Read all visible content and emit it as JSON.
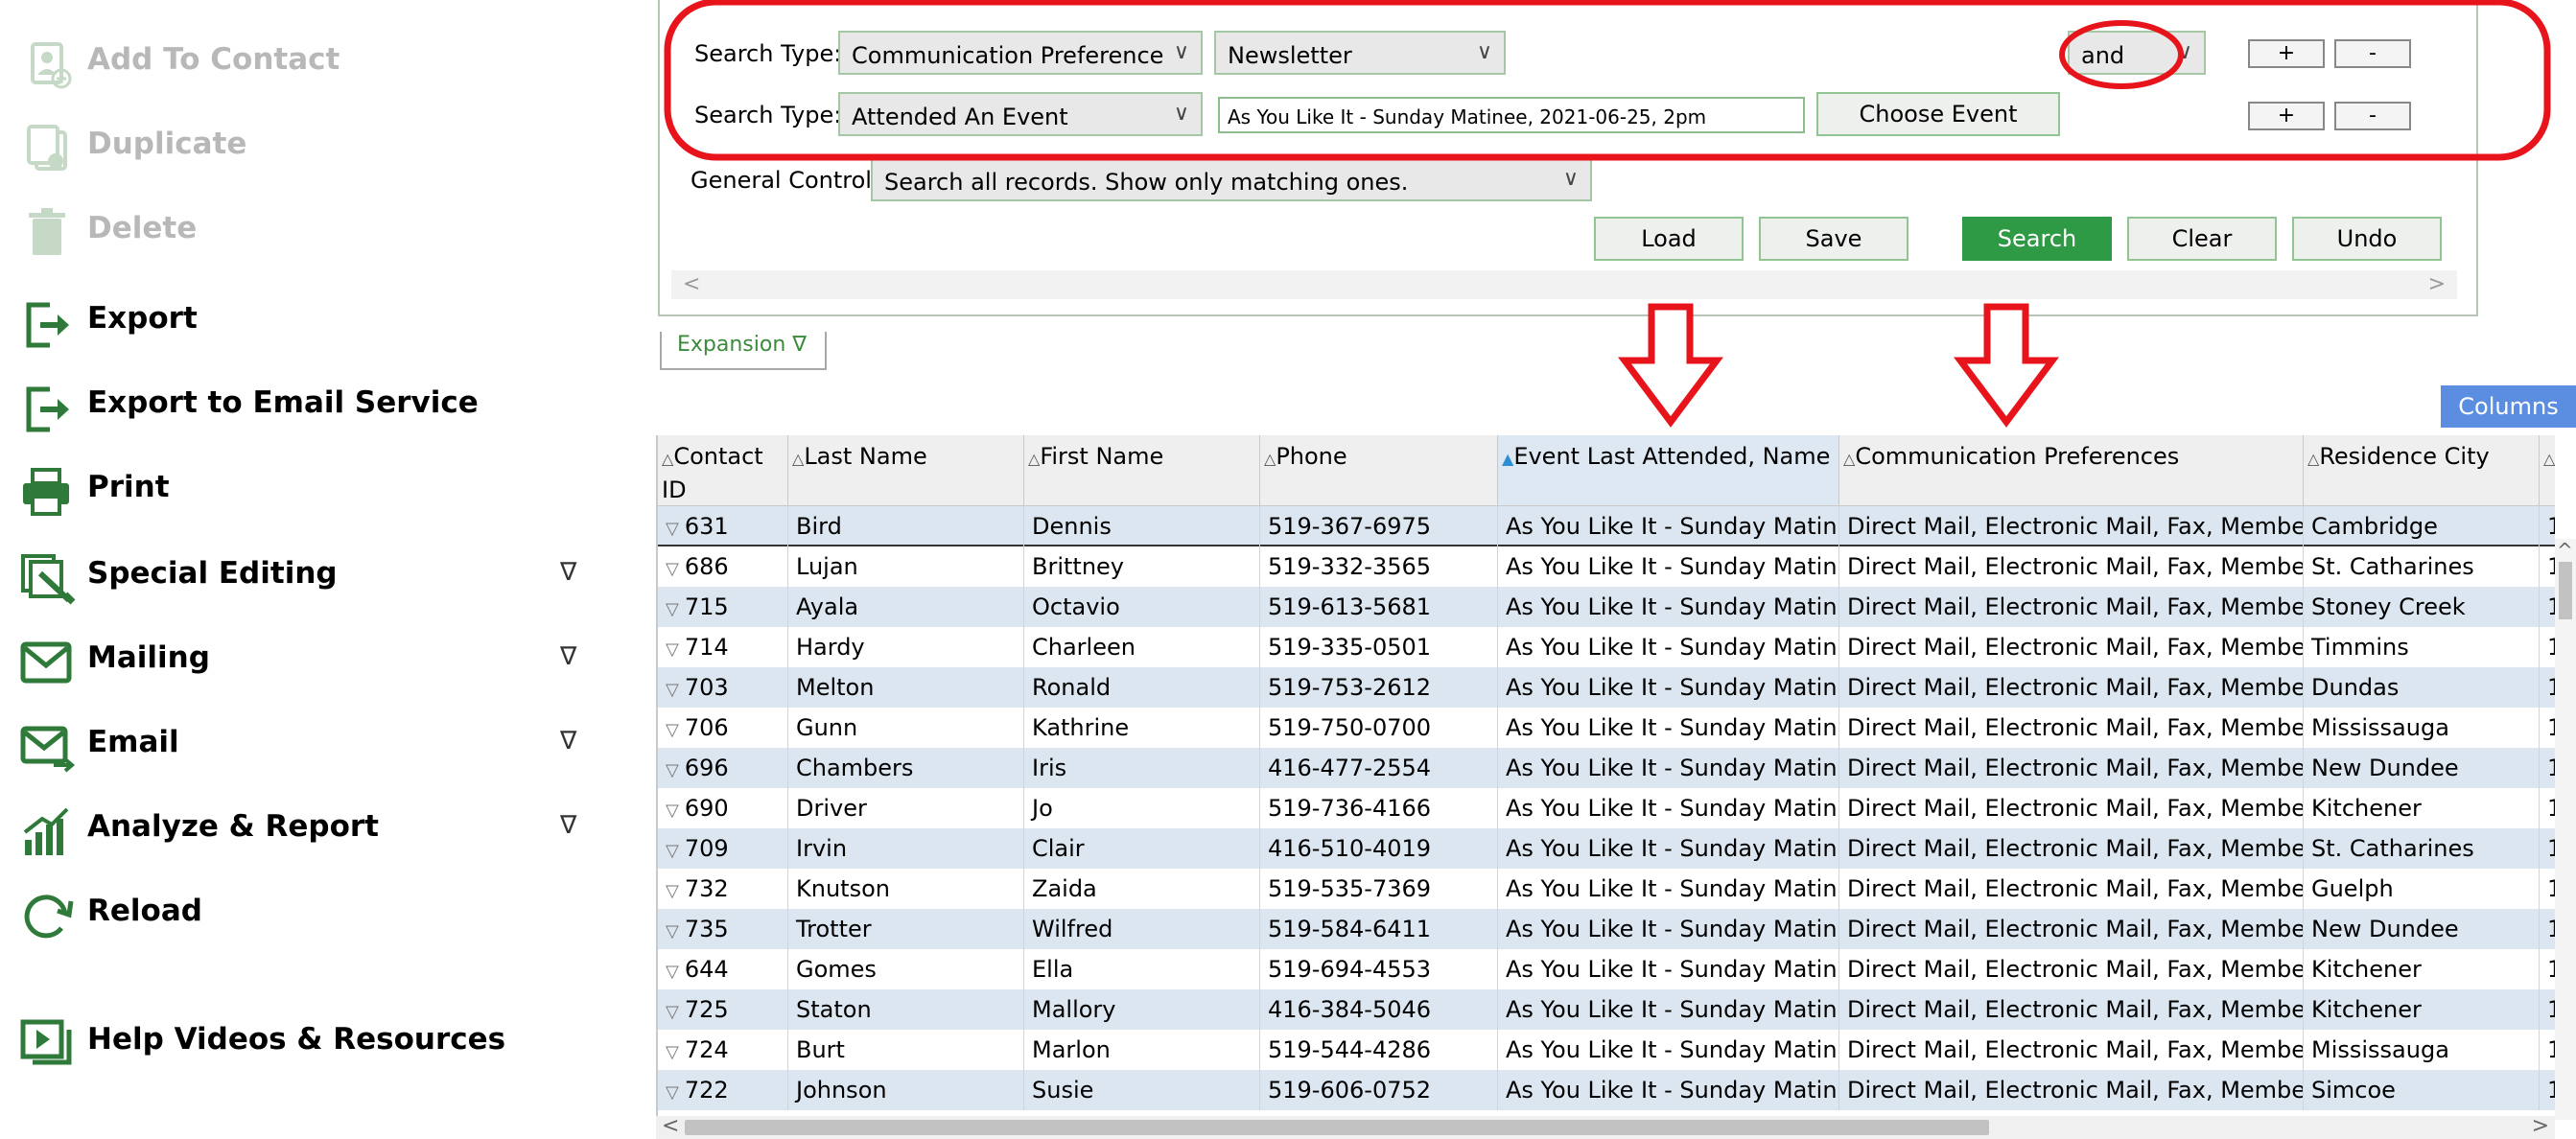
{
  "sidebar": {
    "items": [
      {
        "label": "Add To Contact",
        "icon": "add-to-contact-icon",
        "disabled": true,
        "has_submenu": false
      },
      {
        "label": "Duplicate",
        "icon": "duplicate-icon",
        "disabled": true,
        "has_submenu": false
      },
      {
        "label": "Delete",
        "icon": "trash-icon",
        "disabled": true,
        "has_submenu": false
      },
      {
        "label": "Export",
        "icon": "export-icon",
        "disabled": false,
        "has_submenu": false
      },
      {
        "label": "Export to Email Service",
        "icon": "export-icon",
        "disabled": false,
        "has_submenu": false
      },
      {
        "label": "Print",
        "icon": "printer-icon",
        "disabled": false,
        "has_submenu": false
      },
      {
        "label": "Special Editing",
        "icon": "special-editing-icon",
        "disabled": false,
        "has_submenu": true
      },
      {
        "label": "Mailing",
        "icon": "mail-icon",
        "disabled": false,
        "has_submenu": true
      },
      {
        "label": "Email",
        "icon": "email-icon",
        "disabled": false,
        "has_submenu": true
      },
      {
        "label": "Analyze & Report",
        "icon": "bar-chart-icon",
        "disabled": false,
        "has_submenu": true
      },
      {
        "label": "Reload",
        "icon": "reload-icon",
        "disabled": false,
        "has_submenu": false
      },
      {
        "label": "Help Videos & Resources",
        "icon": "video-help-icon",
        "disabled": false,
        "has_submenu": false
      }
    ],
    "submenu_glyph": "∇"
  },
  "search": {
    "rows": [
      {
        "label": "Search Type:",
        "type_value": "Communication Preference",
        "value": "Newsletter",
        "connector": "and",
        "plus": "+",
        "minus": "-"
      },
      {
        "label": "Search Type:",
        "type_value": "Attended An Event",
        "value": "As You Like It - Sunday Matinee, 2021-06-25, 2pm",
        "choose_button": "Choose Event",
        "plus": "+",
        "minus": "-"
      }
    ],
    "general_control_label": "General Control:",
    "general_control_value": "Search all records. Show only matching ones.",
    "buttons": {
      "load": "Load",
      "save": "Save",
      "search": "Search",
      "clear": "Clear",
      "undo": "Undo"
    }
  },
  "expansion_label": "Expansion ∇",
  "columns_button": "Columns",
  "grid": {
    "headers": [
      {
        "label": "Contact ID"
      },
      {
        "label": "Last Name"
      },
      {
        "label": "First Name"
      },
      {
        "label": "Phone"
      },
      {
        "label": "Event Last Attended, Name",
        "sorted": true
      },
      {
        "label": "Communication Preferences"
      },
      {
        "label": "Residence City"
      },
      {
        "label": ""
      }
    ],
    "rows": [
      [
        "631",
        "Bird",
        "Dennis",
        "519-367-6975",
        "As You Like It - Sunday Matinee",
        "Direct Mail, Electronic Mail, Fax, Member",
        "Cambridge",
        "1"
      ],
      [
        "686",
        "Lujan",
        "Brittney",
        "519-332-3565",
        "As You Like It - Sunday Matinee",
        "Direct Mail, Electronic Mail, Fax, Member",
        "St. Catharines",
        "1"
      ],
      [
        "715",
        "Ayala",
        "Octavio",
        "519-613-5681",
        "As You Like It - Sunday Matinee",
        "Direct Mail, Electronic Mail, Fax, Member",
        "Stoney Creek",
        "1"
      ],
      [
        "714",
        "Hardy",
        "Charleen",
        "519-335-0501",
        "As You Like It - Sunday Matinee",
        "Direct Mail, Electronic Mail, Fax, Member",
        "Timmins",
        "1"
      ],
      [
        "703",
        "Melton",
        "Ronald",
        "519-753-2612",
        "As You Like It - Sunday Matinee",
        "Direct Mail, Electronic Mail, Fax, Member",
        "Dundas",
        "1"
      ],
      [
        "706",
        "Gunn",
        "Kathrine",
        "519-750-0700",
        "As You Like It - Sunday Matinee",
        "Direct Mail, Electronic Mail, Fax, Member",
        "Mississauga",
        "1"
      ],
      [
        "696",
        "Chambers",
        "Iris",
        "416-477-2554",
        "As You Like It - Sunday Matinee",
        "Direct Mail, Electronic Mail, Fax, Member",
        "New Dundee",
        "1"
      ],
      [
        "690",
        "Driver",
        "Jo",
        "519-736-4166",
        "As You Like It - Sunday Matinee",
        "Direct Mail, Electronic Mail, Fax, Member",
        "Kitchener",
        "1"
      ],
      [
        "709",
        "Irvin",
        "Clair",
        "416-510-4019",
        "As You Like It - Sunday Matinee",
        "Direct Mail, Electronic Mail, Fax, Member",
        "St. Catharines",
        "1"
      ],
      [
        "732",
        "Knutson",
        "Zaida",
        "519-535-7369",
        "As You Like It - Sunday Matinee",
        "Direct Mail, Electronic Mail, Fax, Member",
        "Guelph",
        "1"
      ],
      [
        "735",
        "Trotter",
        "Wilfred",
        "519-584-6411",
        "As You Like It - Sunday Matinee",
        "Direct Mail, Electronic Mail, Fax, Member",
        "New Dundee",
        "1"
      ],
      [
        "644",
        "Gomes",
        "Ella",
        "519-694-4553",
        "As You Like It - Sunday Matinee",
        "Direct Mail, Electronic Mail, Fax, Member",
        "Kitchener",
        "1"
      ],
      [
        "725",
        "Staton",
        "Mallory",
        "416-384-5046",
        "As You Like It - Sunday Matinee",
        "Direct Mail, Electronic Mail, Fax, Member",
        "Kitchener",
        "1"
      ],
      [
        "724",
        "Burt",
        "Marlon",
        "519-544-4286",
        "As You Like It - Sunday Matinee",
        "Direct Mail, Electronic Mail, Fax, Member",
        "Mississauga",
        "1"
      ],
      [
        "722",
        "Johnson",
        "Susie",
        "519-606-0752",
        "As You Like It - Sunday Matinee",
        "Direct Mail, Electronic Mail, Fax, Member",
        "Simcoe",
        "1"
      ]
    ]
  },
  "colors": {
    "accent_green": "#2f9a45",
    "annotation_red": "#e8141c",
    "row_alt": "#dce6f1",
    "columns_blue": "#5b8ee0"
  }
}
